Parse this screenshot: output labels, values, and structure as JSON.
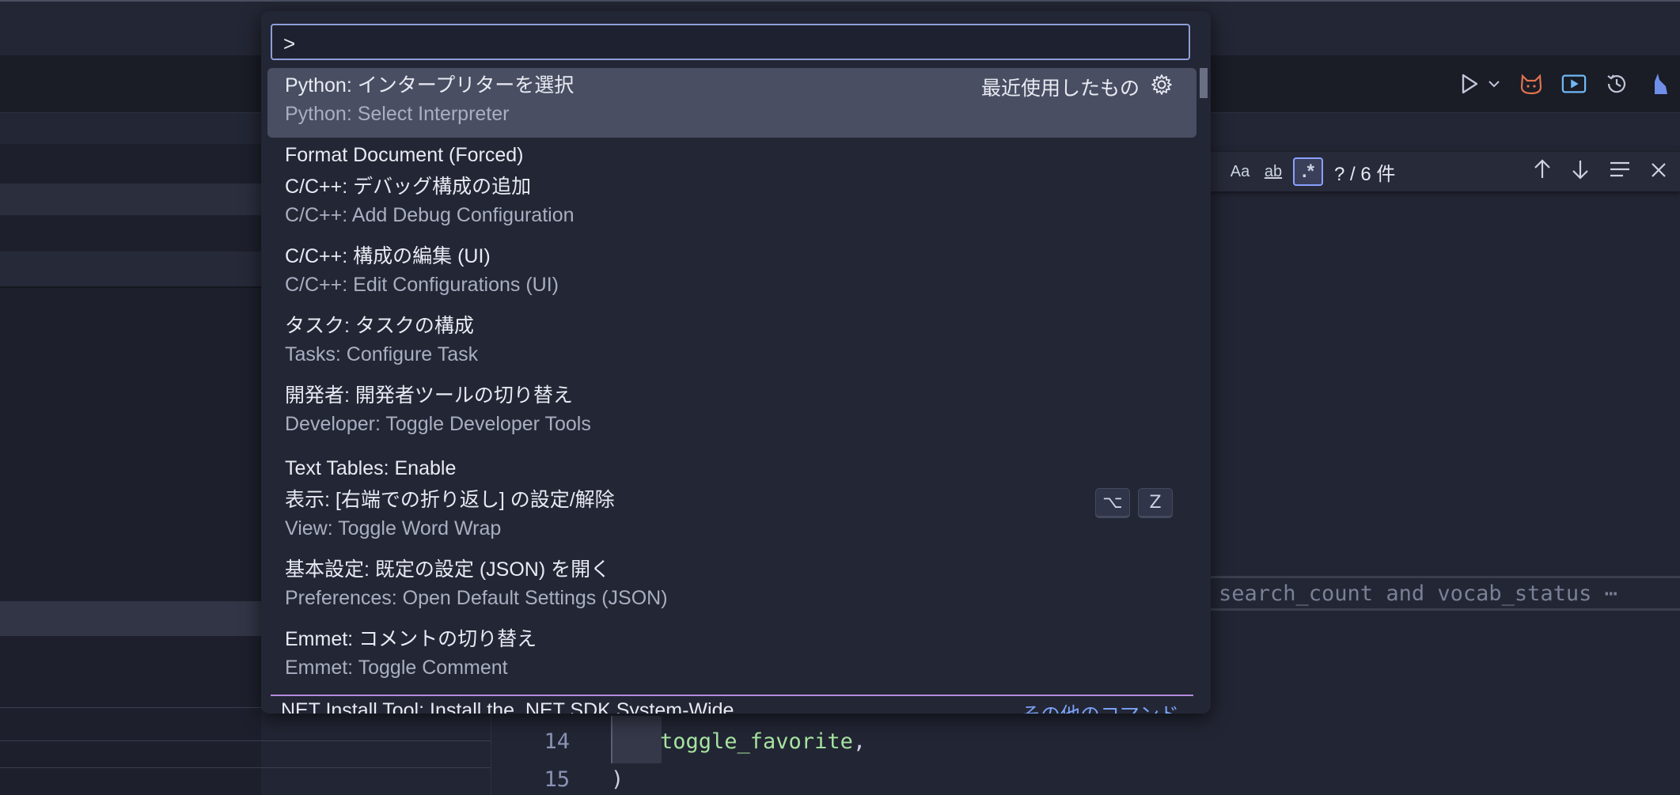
{
  "palette": {
    "input_value": ">",
    "recent_label": "最近使用したもの",
    "items": [
      {
        "label": "Python: インタープリターを選択",
        "detail": "Python: Select Interpreter"
      },
      {
        "label": "Format Document (Forced)",
        "detail": ""
      },
      {
        "label": "C/C++: デバッグ構成の追加",
        "detail": "C/C++: Add Debug Configuration"
      },
      {
        "label": "C/C++: 構成の編集 (UI)",
        "detail": "C/C++: Edit Configurations (UI)"
      },
      {
        "label": "タスク: タスクの構成",
        "detail": "Tasks: Configure Task"
      },
      {
        "label": "開発者: 開発者ツールの切り替え",
        "detail": "Developer: Toggle Developer Tools"
      },
      {
        "label": "Text Tables: Enable",
        "detail": ""
      },
      {
        "label": "表示: [右端での折り返し] の設定/解除",
        "detail": "View: Toggle Word Wrap",
        "keys": [
          "⌥",
          "Z"
        ]
      },
      {
        "label": "基本設定: 既定の設定 (JSON) を開く",
        "detail": "Preferences: Open Default Settings (JSON)"
      },
      {
        "label": "Emmet: コメントの切り替え",
        "detail": "Emmet: Toggle Comment"
      }
    ],
    "footer_text": ".NET Install Tool: Install the .NET SDK System-Wide",
    "footer_link": "その他のコマンド"
  },
  "find_widget": {
    "match_case": "Aa",
    "whole_word": "ab",
    "regex": ".*",
    "count": "? / 6 件"
  },
  "editor": {
    "hint_text": "search_count and vocab_status ⋯",
    "lines": [
      {
        "num": "14",
        "text": "toggle_favorite",
        "punct": ","
      },
      {
        "num": "15",
        "text": "",
        "punct": ")"
      }
    ]
  }
}
